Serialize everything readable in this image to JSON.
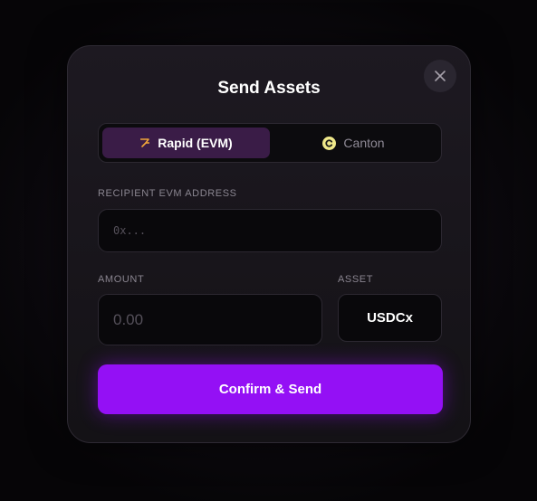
{
  "modal": {
    "title": "Send Assets",
    "close_icon": "close-icon"
  },
  "tabs": [
    {
      "label": "Rapid (EVM)",
      "icon": "rapid-logo-icon",
      "active": true
    },
    {
      "label": "Canton",
      "icon": "canton-logo-icon",
      "active": false
    }
  ],
  "recipient": {
    "label": "RECIPIENT EVM ADDRESS",
    "placeholder": "0x..."
  },
  "amount": {
    "label": "AMOUNT",
    "placeholder": "0.00"
  },
  "asset": {
    "label": "ASSET",
    "value": "USDCx"
  },
  "confirm": {
    "label": "Confirm & Send"
  },
  "colors": {
    "accent": "#9410f5",
    "active_tab": "#3a1c47",
    "rapid_icon": "#f0a53a",
    "canton_icon": "#efe88a"
  }
}
